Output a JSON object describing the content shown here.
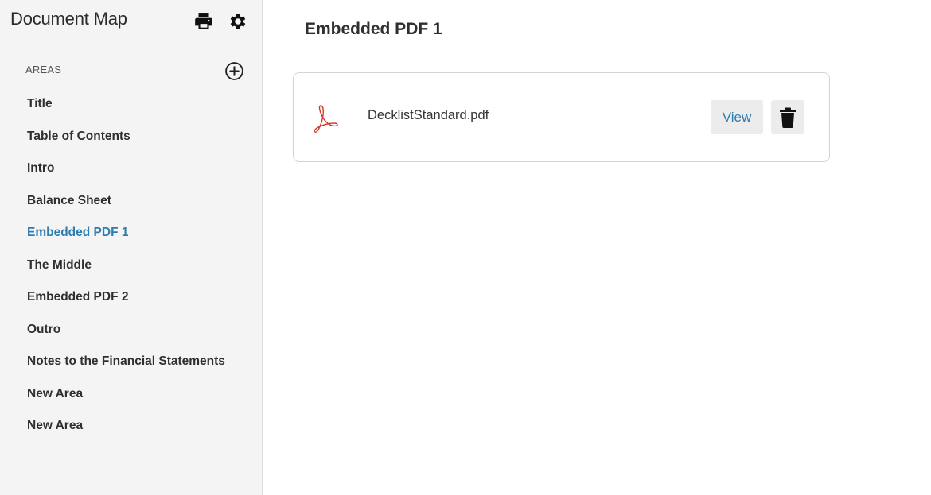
{
  "sidebar": {
    "title": "Document Map",
    "header_icons": [
      "print-icon",
      "gear-icon"
    ],
    "section_label": "AREAS",
    "add_icon": "plus-circle-icon",
    "items": [
      {
        "label": "Title",
        "active": false
      },
      {
        "label": "Table of Contents",
        "active": false
      },
      {
        "label": "Intro",
        "active": false
      },
      {
        "label": "Balance Sheet",
        "active": false
      },
      {
        "label": "Embedded PDF 1",
        "active": true
      },
      {
        "label": "The Middle",
        "active": false
      },
      {
        "label": "Embedded PDF 2",
        "active": false
      },
      {
        "label": "Outro",
        "active": false
      },
      {
        "label": "Notes to the Financial Statements",
        "active": false
      },
      {
        "label": "New Area",
        "active": false
      },
      {
        "label": "New Area",
        "active": false
      }
    ]
  },
  "main": {
    "title": "Embedded PDF 1",
    "file": {
      "icon": "pdf-icon",
      "name": "DecklistStandard.pdf",
      "view_label": "View",
      "delete_icon": "trash-icon"
    }
  },
  "colors": {
    "accent": "#2e7db0",
    "sidebar_bg": "#f4f4f4",
    "button_bg": "#ececec",
    "pdf_red": "#d33a2c"
  }
}
